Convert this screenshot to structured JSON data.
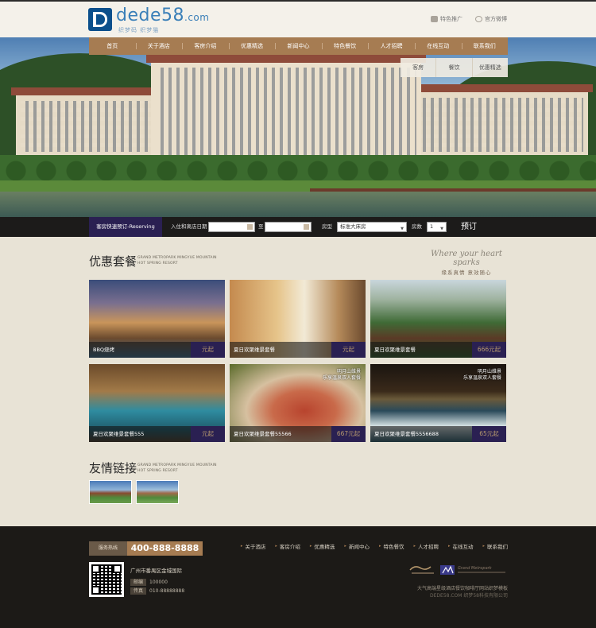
{
  "header": {
    "logo_text": "dede58",
    "logo_suffix": ".com",
    "logo_subtitle": "织梦码 织梦猫",
    "links": [
      {
        "label": "特色推广",
        "icon": "promo-icon"
      },
      {
        "label": "官方微博",
        "icon": "weibo-icon"
      }
    ]
  },
  "nav": {
    "items": [
      "首页",
      "关于酒店",
      "客房介绍",
      "优惠精选",
      "新闻中心",
      "特色餐饮",
      "人才招聘",
      "在线互动",
      "联系我们"
    ]
  },
  "subnav": {
    "items": [
      "客房",
      "餐饮",
      "优惠精选"
    ]
  },
  "booking": {
    "tab_label": "客房快速预订-Reserving",
    "checkin_label": "入住和离店日期",
    "to_label": "至",
    "room_type_label": "房型",
    "room_type_value": "标准大床房",
    "room_count_label": "房数",
    "room_count_value": "1",
    "submit_label": "预订"
  },
  "packages": {
    "title": "优惠套餐",
    "subtitle_line1": "GRAND METROPARK MINGYUE MOUNTAIN",
    "subtitle_line2": "HOT SPRING RESORT",
    "slogan_script": "Where your heart sparks",
    "slogan_cn": "缘系真情 意效随心",
    "items": [
      {
        "name": "BBQ烧烤",
        "price": "元起",
        "tag_line1": "",
        "tag_line2": ""
      },
      {
        "name": "夏日欢聚维景套餐",
        "price": "元起",
        "tag_line1": "",
        "tag_line2": ""
      },
      {
        "name": "夏日欢聚维景套餐",
        "price": "666元起",
        "tag_line1": "",
        "tag_line2": ""
      },
      {
        "name": "夏日欢聚维景套餐555",
        "price": "元起",
        "tag_line1": "",
        "tag_line2": ""
      },
      {
        "name": "夏日欢聚维景套餐55566",
        "price": "667元起",
        "tag_line1": "明月山维景",
        "tag_line2": "乐享温泉双人套餐"
      },
      {
        "name": "夏日欢聚维景套餐5556688",
        "price": "65元起",
        "tag_line1": "明月山维景",
        "tag_line2": "乐享温泉双人套餐"
      }
    ]
  },
  "friends": {
    "title": "友情链接",
    "subtitle_line1": "GRAND METROPARK MINGYUE MOUNTAIN",
    "subtitle_line2": "HOT SPRING RESORT"
  },
  "footer": {
    "hotline_label": "服务热线",
    "hotline_number": "400-888-8888",
    "address": "广州市番禺区金城国际",
    "zip_label": "邮编",
    "zip_value": "100000",
    "phone_label": "传真",
    "phone_value": "010-88888888",
    "nav": [
      "关于酒店",
      "客房介绍",
      "优惠精选",
      "新闻中心",
      "特色餐饮",
      "人才招聘",
      "在线互动",
      "联系我们"
    ],
    "copyright_line1": "大气高端星级酒店餐饮咖啡厅网站织梦模板",
    "copyright_line2": "DEDE58.COM 织梦58科技有限公司"
  },
  "colors": {
    "accent_brown": "#a67c52",
    "deep_purple": "#2a2052",
    "footer_bg": "#1c1a17",
    "logo_blue": "#0b4f8c"
  }
}
